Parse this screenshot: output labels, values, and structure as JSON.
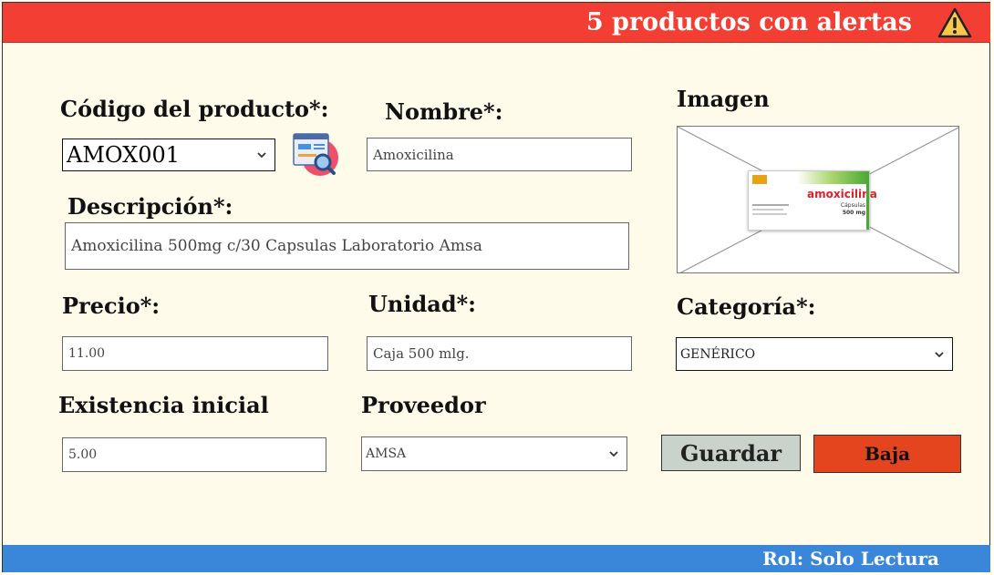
{
  "header": {
    "alert_text": "5 productos con alertas",
    "alert_icon": "warning-icon"
  },
  "footer": {
    "role_text": "Rol: Solo Lectura"
  },
  "form": {
    "codigo": {
      "label": "Código del producto*:",
      "value": "AMOX001"
    },
    "search_icon": "product-search-icon",
    "nombre": {
      "label": "Nombre*:",
      "value": "Amoxicilina"
    },
    "imagen": {
      "label": "Imagen",
      "brand": "amoxicilina",
      "sub1": "Cápsulas",
      "sub2": "500 mg"
    },
    "descripcion": {
      "label": "Descripción*:",
      "value": "Amoxicilina 500mg c/30 Capsulas Laboratorio Amsa"
    },
    "precio": {
      "label": "Precio*:",
      "value": "11.00"
    },
    "unidad": {
      "label": "Unidad*:",
      "value": "Caja 500 mlg."
    },
    "categoria": {
      "label": "Categoría*:",
      "value": "GENÉRICO"
    },
    "existencia": {
      "label": "Existencia inicial",
      "value": "5.00"
    },
    "proveedor": {
      "label": "Proveedor",
      "value": "AMSA"
    }
  },
  "buttons": {
    "save_label": "Guardar",
    "delete_label": "Baja"
  },
  "colors": {
    "header_bg": "#f33e34",
    "footer_bg": "#3a86d8",
    "save_bg": "#c9d3cc",
    "delete_bg": "#e4441e",
    "page_bg": "#fffbeb"
  }
}
